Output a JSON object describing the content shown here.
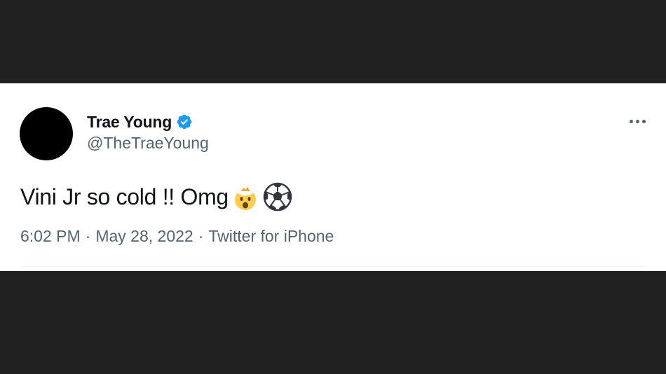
{
  "tweet": {
    "author_name": "Trae Young",
    "author_handle": "@TheTraeYoung",
    "verified": true,
    "text": "Vini Jr so cold !! Omg",
    "emojis": [
      "exploding-head-emoji",
      "soccer-ball-emoji"
    ],
    "time": "6:02 PM",
    "date": "May 28, 2022",
    "source": "Twitter for iPhone",
    "separator": "·"
  },
  "colors": {
    "background": "#212121",
    "card": "#ffffff",
    "text_primary": "#0f1419",
    "text_secondary": "#536471",
    "verified_blue": "#1d9bf0"
  },
  "icons": {
    "verified": "verified-badge-icon",
    "more": "more-options-icon"
  }
}
